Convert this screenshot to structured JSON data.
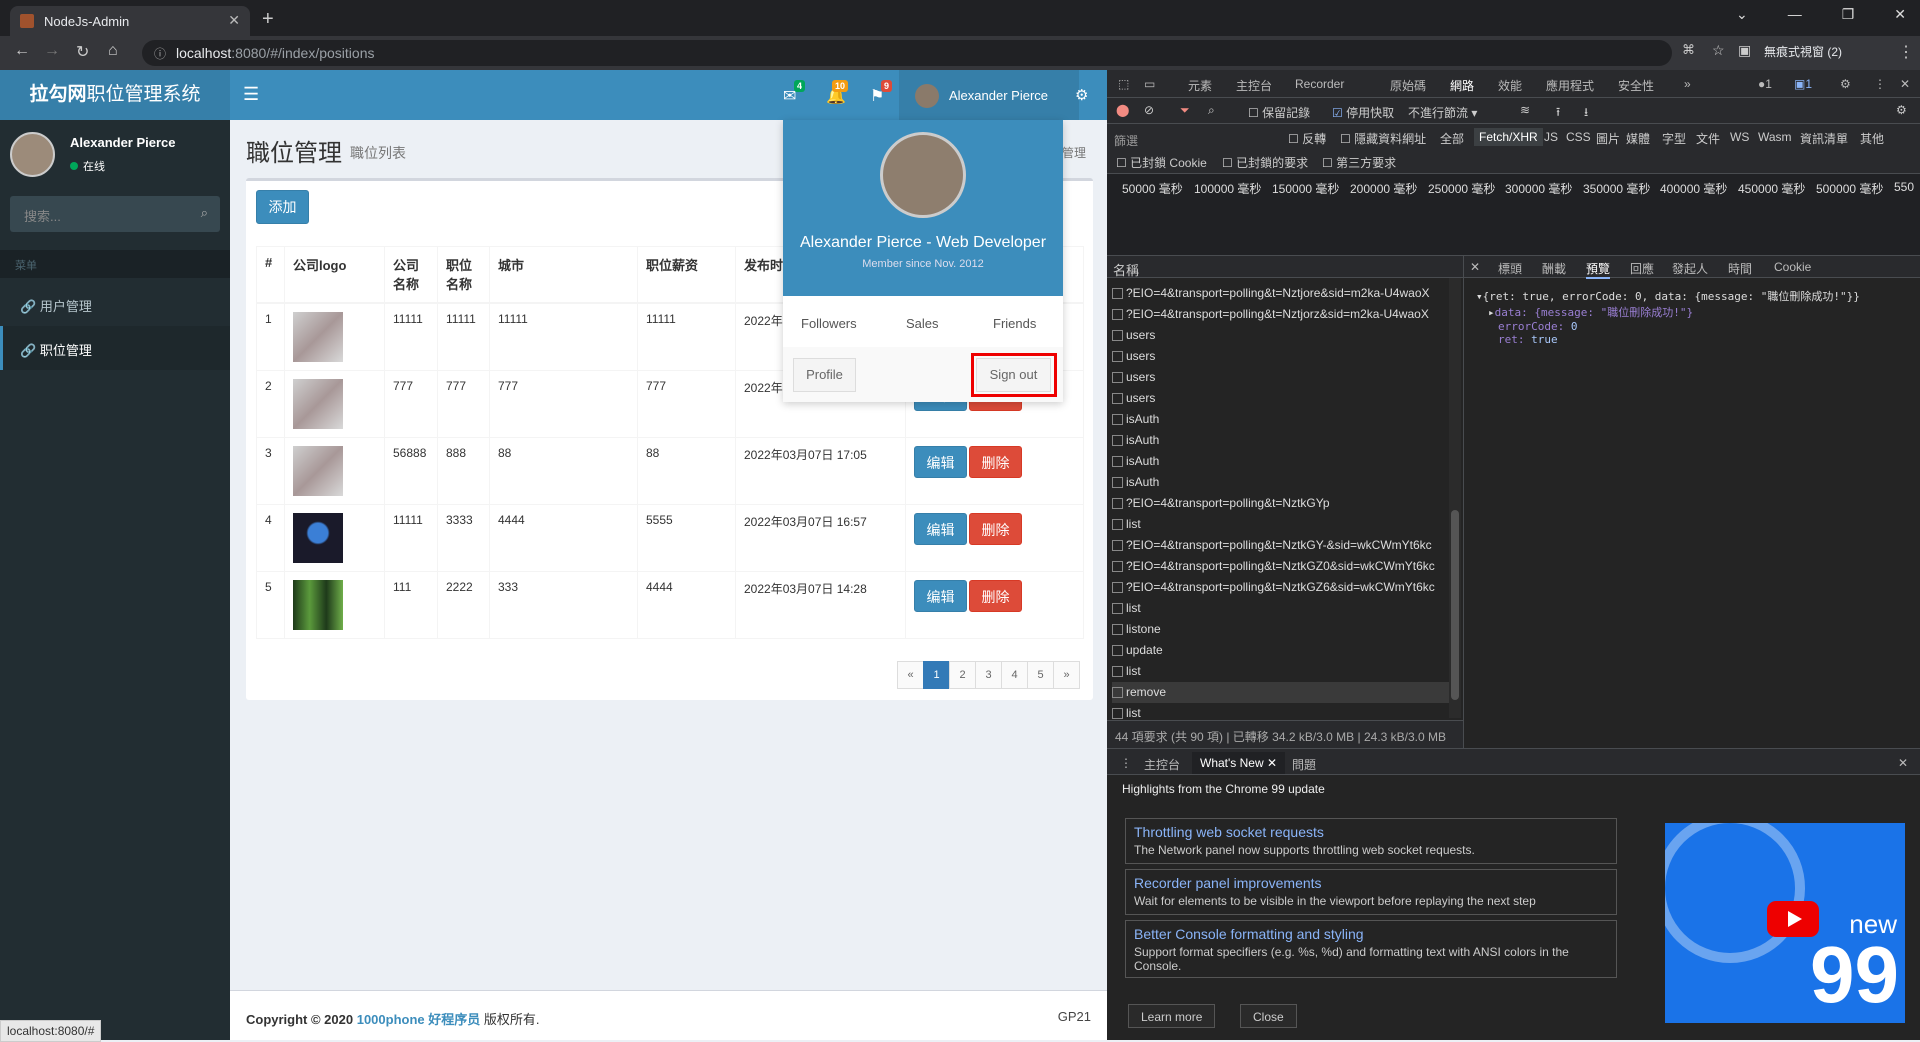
{
  "browser": {
    "tab_title": "NodeJs-Admin",
    "url_host": "localhost",
    "url_rest": ":8080/#/index/positions",
    "incognito_label": "無痕式視窗 (2)"
  },
  "app": {
    "logo_bold": "拉勾网",
    "logo_rest": "职位管理系统",
    "badges": {
      "mail": "4",
      "bell": "10",
      "flag": "9"
    },
    "header_user": "Alexander Pierce",
    "sidebar": {
      "user_name": "Alexander Pierce",
      "status": "在线",
      "search_placeholder": "搜索...",
      "menu_header": "菜单",
      "items": [
        {
          "label": "用户管理"
        },
        {
          "label": "职位管理"
        }
      ]
    },
    "page_title": "職位管理",
    "page_subtitle": "職位列表",
    "breadcrumb": "位管理",
    "add_label": "添加",
    "table": {
      "headers": [
        "#",
        "公司logo",
        "公司名称",
        "职位名称",
        "城市",
        "职位薪资",
        "发布时间"
      ],
      "rows": [
        {
          "n": "1",
          "company": "11111",
          "position": "11111",
          "city": "11111",
          "salary": "11111",
          "time": "2022年0"
        },
        {
          "n": "2",
          "company": "777",
          "position": "777",
          "city": "777",
          "salary": "777",
          "time": "2022年0"
        },
        {
          "n": "3",
          "company": "56888",
          "position": "888",
          "city": "88",
          "salary": "88",
          "time": "2022年03月07日 17:05"
        },
        {
          "n": "4",
          "company": "11111",
          "position": "3333",
          "city": "4444",
          "salary": "5555",
          "time": "2022年03月07日 16:57"
        },
        {
          "n": "5",
          "company": "111",
          "position": "2222",
          "city": "333",
          "salary": "4444",
          "time": "2022年03月07日 14:28"
        }
      ],
      "edit_label": "编辑",
      "delete_label": "删除"
    },
    "pager": [
      "«",
      "1",
      "2",
      "3",
      "4",
      "5",
      "»"
    ],
    "footer_left_a": "Copyright © 2020 ",
    "footer_left_b": "1000phone 好程序员",
    "footer_left_c": " 版权所有.",
    "footer_right": "GP21",
    "status_url": "localhost:8080/#",
    "dropdown": {
      "name": "Alexander Pierce - Web Developer",
      "since": "Member since Nov. 2012",
      "links": [
        "Followers",
        "Sales",
        "Friends"
      ],
      "profile": "Profile",
      "signout": "Sign out"
    }
  },
  "devtools": {
    "tabs": [
      "元素",
      "主控台",
      "Recorder",
      "原始碼",
      "網路",
      "效能",
      "應用程式",
      "安全性"
    ],
    "toolbar": {
      "preserve": "保留記錄",
      "disable_cache": "停用快取",
      "throttle": "不進行節流"
    },
    "filter": {
      "label": "篩選",
      "invert": "反轉",
      "hide_data": "隱藏資料網址",
      "types": [
        "全部",
        "Fetch/XHR",
        "JS",
        "CSS",
        "圖片",
        "媒體",
        "字型",
        "文件",
        "WS",
        "Wasm",
        "資訊清單",
        "其他"
      ],
      "blocked_cookies": "已封鎖 Cookie",
      "blocked_requests": "已封鎖的要求",
      "third_party": "第三方要求"
    },
    "timeline": [
      "50000 毫秒",
      "100000 毫秒",
      "150000 毫秒",
      "200000 毫秒",
      "250000 毫秒",
      "300000 毫秒",
      "350000 毫秒",
      "400000 毫秒",
      "450000 毫秒",
      "500000 毫秒",
      "550"
    ],
    "name_header": "名稱",
    "requests": [
      "?EIO=4&transport=polling&t=Nztjore&sid=m2ka-U4waoX",
      "?EIO=4&transport=polling&t=Nztjorz&sid=m2ka-U4waoX",
      "users",
      "users",
      "users",
      "users",
      "isAuth",
      "isAuth",
      "isAuth",
      "isAuth",
      "?EIO=4&transport=polling&t=NztkGYp",
      "list",
      "?EIO=4&transport=polling&t=NztkGY-&sid=wkCWmYt6kc",
      "?EIO=4&transport=polling&t=NztkGZ0&sid=wkCWmYt6kc",
      "?EIO=4&transport=polling&t=NztkGZ6&sid=wkCWmYt6kc",
      "list",
      "listone",
      "update",
      "list",
      "remove",
      "list"
    ],
    "summary": "44 項要求 (共 90 項)  |  已轉移 34.2 kB/3.0 MB  |  24.3 kB/3.0 MB",
    "preview_tabs": [
      "標頭",
      "酬載",
      "預覽",
      "回應",
      "發起人",
      "時間",
      "Cookie"
    ],
    "preview": {
      "line1": "{ret: true, errorCode: 0, data: {message: \"職位刪除成功!\"}}",
      "line2": "data: {message: \"職位刪除成功!\"}",
      "line3a": "errorCode: ",
      "line3b": "0",
      "line4a": "ret: ",
      "line4b": "true"
    },
    "drawer_tabs": [
      "主控台",
      "What's New",
      "問題"
    ],
    "highlights": "Highlights from the Chrome 99 update",
    "cards": [
      {
        "title": "Throttling web socket requests",
        "desc": "The Network panel now supports throttling web socket requests."
      },
      {
        "title": "Recorder panel improvements",
        "desc": "Wait for elements to be visible in the viewport before replaying the next step"
      },
      {
        "title": "Better Console formatting and styling",
        "desc": "Support format specifiers (e.g. %s, %d) and formatting text with ANSI colors in the Console."
      }
    ],
    "video": {
      "new": "new",
      "num": "99"
    },
    "learn_more": "Learn more",
    "close": "Close"
  }
}
